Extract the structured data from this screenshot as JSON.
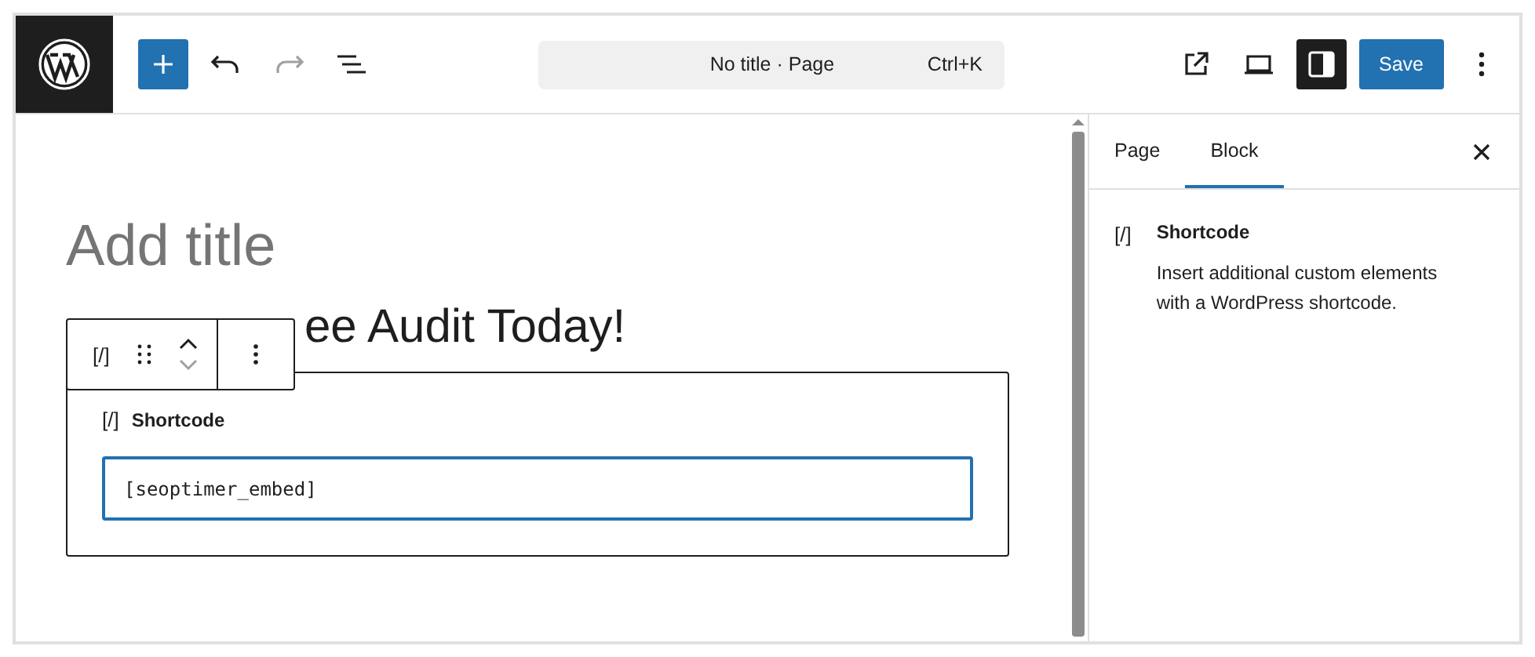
{
  "header": {
    "document_title": "No title · Page",
    "shortcut": "Ctrl+K",
    "save_label": "Save",
    "redo_disabled": true,
    "sidebar_open": true
  },
  "editor": {
    "title_placeholder": "Add title",
    "heading": "ee Audit Today!",
    "block_toolbar": {
      "block_icon": "[/]",
      "move_down_disabled": true
    },
    "block": {
      "icon": "[/]",
      "label": "Shortcode",
      "value": "[seoptimer_embed]"
    }
  },
  "sidebar": {
    "tabs": [
      {
        "label": "Page",
        "selected": false
      },
      {
        "label": "Block",
        "selected": true
      }
    ],
    "block_card": {
      "icon": "[/]",
      "title": "Shortcode",
      "description": "Insert additional custom elements with a WordPress shortcode."
    }
  }
}
